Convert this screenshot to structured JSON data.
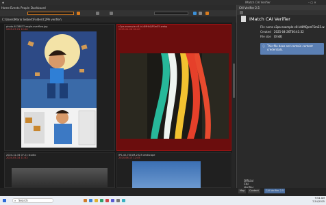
{
  "window": {
    "title": "IMatch CAI Verifier"
  },
  "menu": [
    "Home",
    "Events",
    "People",
    "Dashboard"
  ],
  "path": "C:\\Users\\Mario Siebert\\Folder\\C2PA verifier\\",
  "thumbs": [
    {
      "name": "photo-6138877-eagle-overflow.jpg",
      "meta": "2023-07-21 12:00",
      "selected": false
    },
    {
      "name": "c2pa-example-c8-id-4MHkQFSmE5.webp",
      "meta": "2025-04-26 00:00",
      "selected": true
    },
    {
      "name": "2024-12-34 07.21 studio",
      "meta": "2024-05-14 11:52",
      "selected": false
    },
    {
      "name": "IPS-40-7001M-2023 landscape",
      "meta": "2024-06-13 12:45",
      "selected": false
    }
  ],
  "panel": {
    "header": "CAI Verifier 2.5",
    "title": "IMatch CAI Verifier",
    "fields": [
      {
        "label": "File name",
        "value": "c2pa-example-c8-id4MQpmFSmE5.webp"
      },
      {
        "label": "Created",
        "value": "2025-04-26T00:41:32"
      },
      {
        "label": "File size",
        "value": "[0 kB]"
      }
    ],
    "warning": "This file does not contain content credentials.",
    "footer": "Official CAI Verifier"
  },
  "tabs": [
    "Map",
    "Content",
    "CAI Verifier 2.5"
  ],
  "taskbar": {
    "search": "Search",
    "time": "9:54 AM",
    "date": "7/14/2025"
  }
}
